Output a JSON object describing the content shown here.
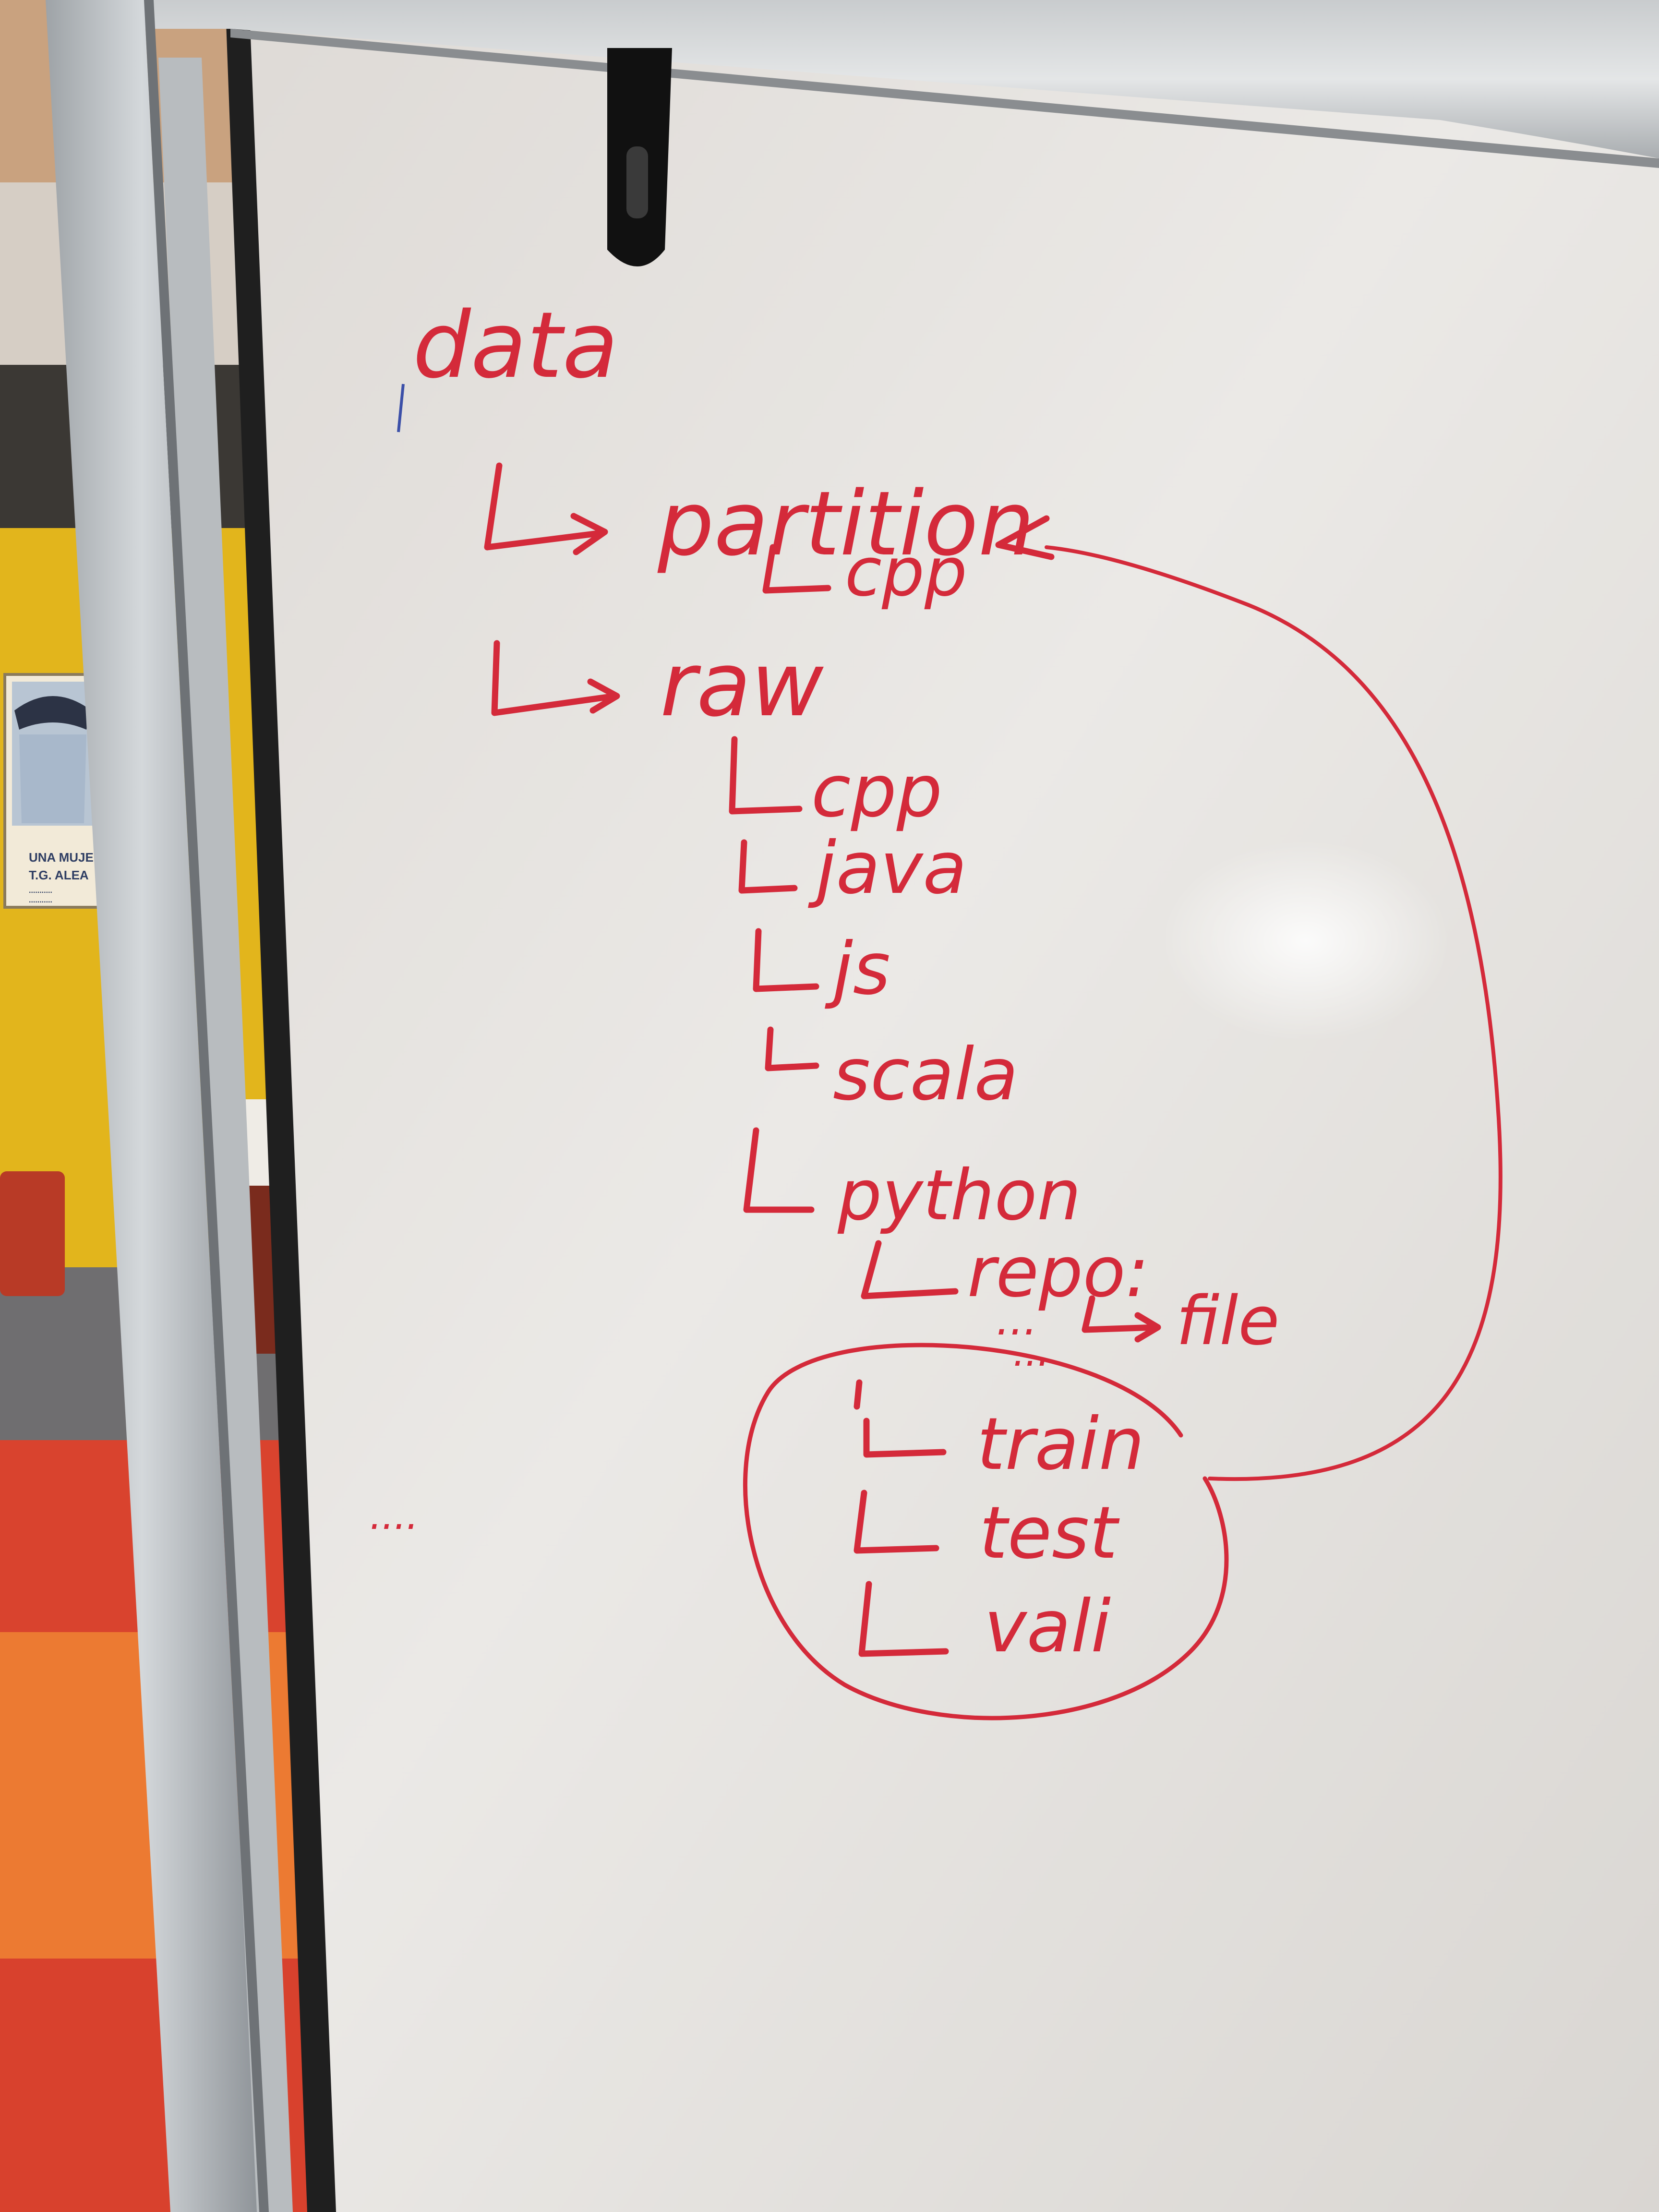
{
  "colors": {
    "marker_red": "#d42a3a",
    "board_white": "#e8e6e3",
    "back_wall_yellow": "#e2b51c",
    "floor_orange": "#ec7a32"
  },
  "whiteboard": {
    "root": "data",
    "partition": {
      "label": "partition",
      "child": "cpp"
    },
    "raw": {
      "label": "raw",
      "languages": [
        "cpp",
        "java",
        "js",
        "scala"
      ],
      "python": {
        "label": "python",
        "repo_label": "repo:",
        "file_label": "file",
        "ellipsis_upper": "...",
        "ellipsis_lower": "...",
        "splits": [
          "train",
          "test",
          "vali"
        ]
      }
    },
    "stray_dots": "...."
  },
  "poster": {
    "line1": "UNA MUJER S",
    "line2": "T.G. ALEA",
    "line3": "...........",
    "line4": "..........."
  }
}
